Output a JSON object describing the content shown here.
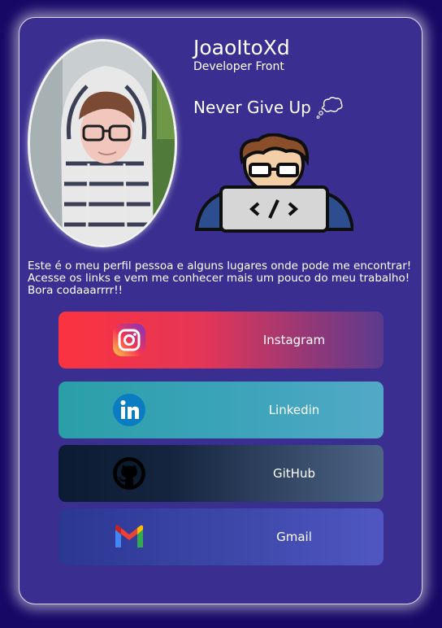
{
  "profile": {
    "username": "JoaoItoXd",
    "role": "Developer Front",
    "motto": "Never Give Up",
    "bio": "Este é o meu perfil pessoa e alguns lugares onde pode me encontrar! Acesse os links e vem me conhecer mais um pouco do meu trabalho! Bora codaaarrrr!!"
  },
  "links": [
    {
      "label": "Instagram",
      "icon": "instagram-icon"
    },
    {
      "label": "Linkedin",
      "icon": "linkedin-icon"
    },
    {
      "label": "GitHub",
      "icon": "github-icon"
    },
    {
      "label": "Gmail",
      "icon": "gmail-icon"
    }
  ],
  "colors": {
    "background": "#180866",
    "card": "#3a2f90",
    "instagram": "#fb3340",
    "linkedin": "#2a9fa8",
    "github": "#0b1b33",
    "gmail": "#2c3793"
  }
}
